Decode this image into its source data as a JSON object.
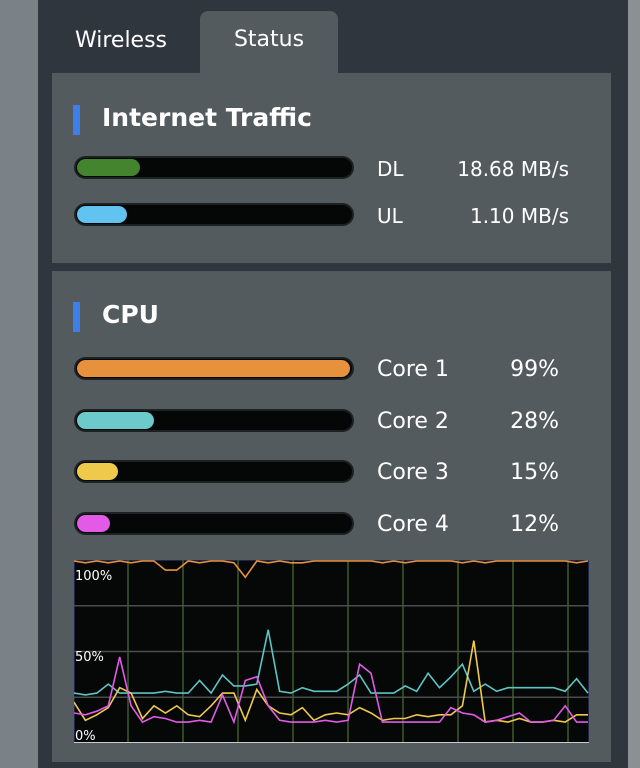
{
  "tabs": [
    {
      "label": "Wireless",
      "active": false
    },
    {
      "label": "Status",
      "active": true
    }
  ],
  "traffic": {
    "title": "Internet Traffic",
    "rows": [
      {
        "label": "DL",
        "value": "18.68 MB/s",
        "fill_percent": 23,
        "color": "#44842f"
      },
      {
        "label": "UL",
        "value": "1.10 MB/s",
        "fill_percent": 18,
        "color": "#62c3f1"
      }
    ]
  },
  "cpu": {
    "title": "CPU",
    "cores": [
      {
        "label": "Core 1",
        "value": "99%",
        "fill_percent": 99,
        "color": "#e8913c"
      },
      {
        "label": "Core 2",
        "value": "28%",
        "fill_percent": 28,
        "color": "#6ccaca"
      },
      {
        "label": "Core 3",
        "value": "15%",
        "fill_percent": 15,
        "color": "#efc94c"
      },
      {
        "label": "Core 4",
        "value": "12%",
        "fill_percent": 12,
        "color": "#e25ae6"
      }
    ]
  },
  "chart_data": {
    "type": "line",
    "ylim": [
      0,
      100
    ],
    "grid": true,
    "yticks": [
      {
        "value": 100,
        "label": "100%"
      },
      {
        "value": 50,
        "label": "50%"
      },
      {
        "value": 0,
        "label": "0%"
      }
    ],
    "series": [
      {
        "core": "Core 1",
        "color": "#e8913c",
        "values": [
          100,
          99,
          100,
          99,
          100,
          99,
          100,
          100,
          95,
          95,
          100,
          99,
          100,
          100,
          99,
          91,
          100,
          99,
          100,
          99,
          99,
          100,
          100,
          100,
          100,
          100,
          100,
          99,
          100,
          99,
          100,
          100,
          100,
          100,
          99,
          100,
          99,
          100,
          100,
          100,
          100,
          100,
          100,
          100,
          99,
          100
        ]
      },
      {
        "core": "Core 2",
        "color": "#5ec4c4",
        "values": [
          27,
          26,
          27,
          32,
          27,
          27,
          27,
          27,
          28,
          27,
          27,
          34,
          27,
          37,
          31,
          31,
          32,
          62,
          28,
          27,
          30,
          28,
          28,
          28,
          32,
          37,
          27,
          27,
          27,
          31,
          28,
          38,
          30,
          36,
          43,
          28,
          32,
          28,
          30,
          30,
          30,
          30,
          30,
          28,
          35,
          27
        ]
      },
      {
        "core": "Core 3",
        "color": "#efc94c",
        "values": [
          22,
          12,
          15,
          19,
          30,
          27,
          13,
          20,
          16,
          20,
          15,
          14,
          20,
          27,
          27,
          12,
          29,
          20,
          16,
          15,
          19,
          12,
          15,
          16,
          15,
          19,
          16,
          12,
          13,
          13,
          15,
          14,
          15,
          15,
          20,
          56,
          11,
          12,
          11,
          13,
          11,
          11,
          12,
          11,
          15,
          15
        ]
      },
      {
        "core": "Core 4",
        "color": "#e25ae6",
        "values": [
          16,
          15,
          17,
          20,
          47,
          20,
          11,
          14,
          13,
          11,
          11,
          12,
          11,
          26,
          11,
          34,
          36,
          20,
          12,
          11,
          11,
          11,
          12,
          11,
          12,
          43,
          38,
          11,
          11,
          11,
          11,
          11,
          11,
          19,
          16,
          15,
          11,
          12,
          14,
          16,
          11,
          11,
          12,
          20,
          11,
          11
        ]
      }
    ]
  }
}
